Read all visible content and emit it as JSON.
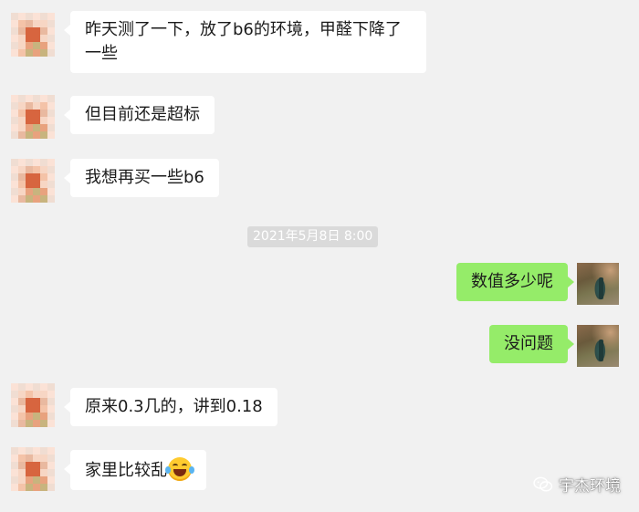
{
  "messages": [
    {
      "side": "left",
      "text": "昨天测了一下，放了b6的环境，甲醛下降了一些"
    },
    {
      "side": "left",
      "text": "但目前还是超标"
    },
    {
      "side": "left",
      "text": "我想再买一些b6"
    },
    {
      "side": "right",
      "text": "数值多少呢"
    },
    {
      "side": "right",
      "text": "没问题"
    },
    {
      "side": "left",
      "text": "原来0.3几的，讲到0.18"
    },
    {
      "side": "left",
      "text": "家里比较乱",
      "emoji": "laughing-tears-emoji"
    }
  ],
  "timestamp": "2021年5月8日 8:00",
  "watermark": {
    "text": "宇杰环境",
    "icon": "wechat-official-account-icon"
  },
  "colors": {
    "background": "#f1f1f1",
    "left_bubble": "#ffffff",
    "right_bubble": "#95ec69"
  },
  "mosaic_palette": [
    "#fbe2d6",
    "#f4c3a8",
    "#e8a27e",
    "#d7653f",
    "#e9b9a0",
    "#c8b47e",
    "#f7d6c4",
    "#efc9b4",
    "#d9a68c",
    "#f0ddd2"
  ]
}
